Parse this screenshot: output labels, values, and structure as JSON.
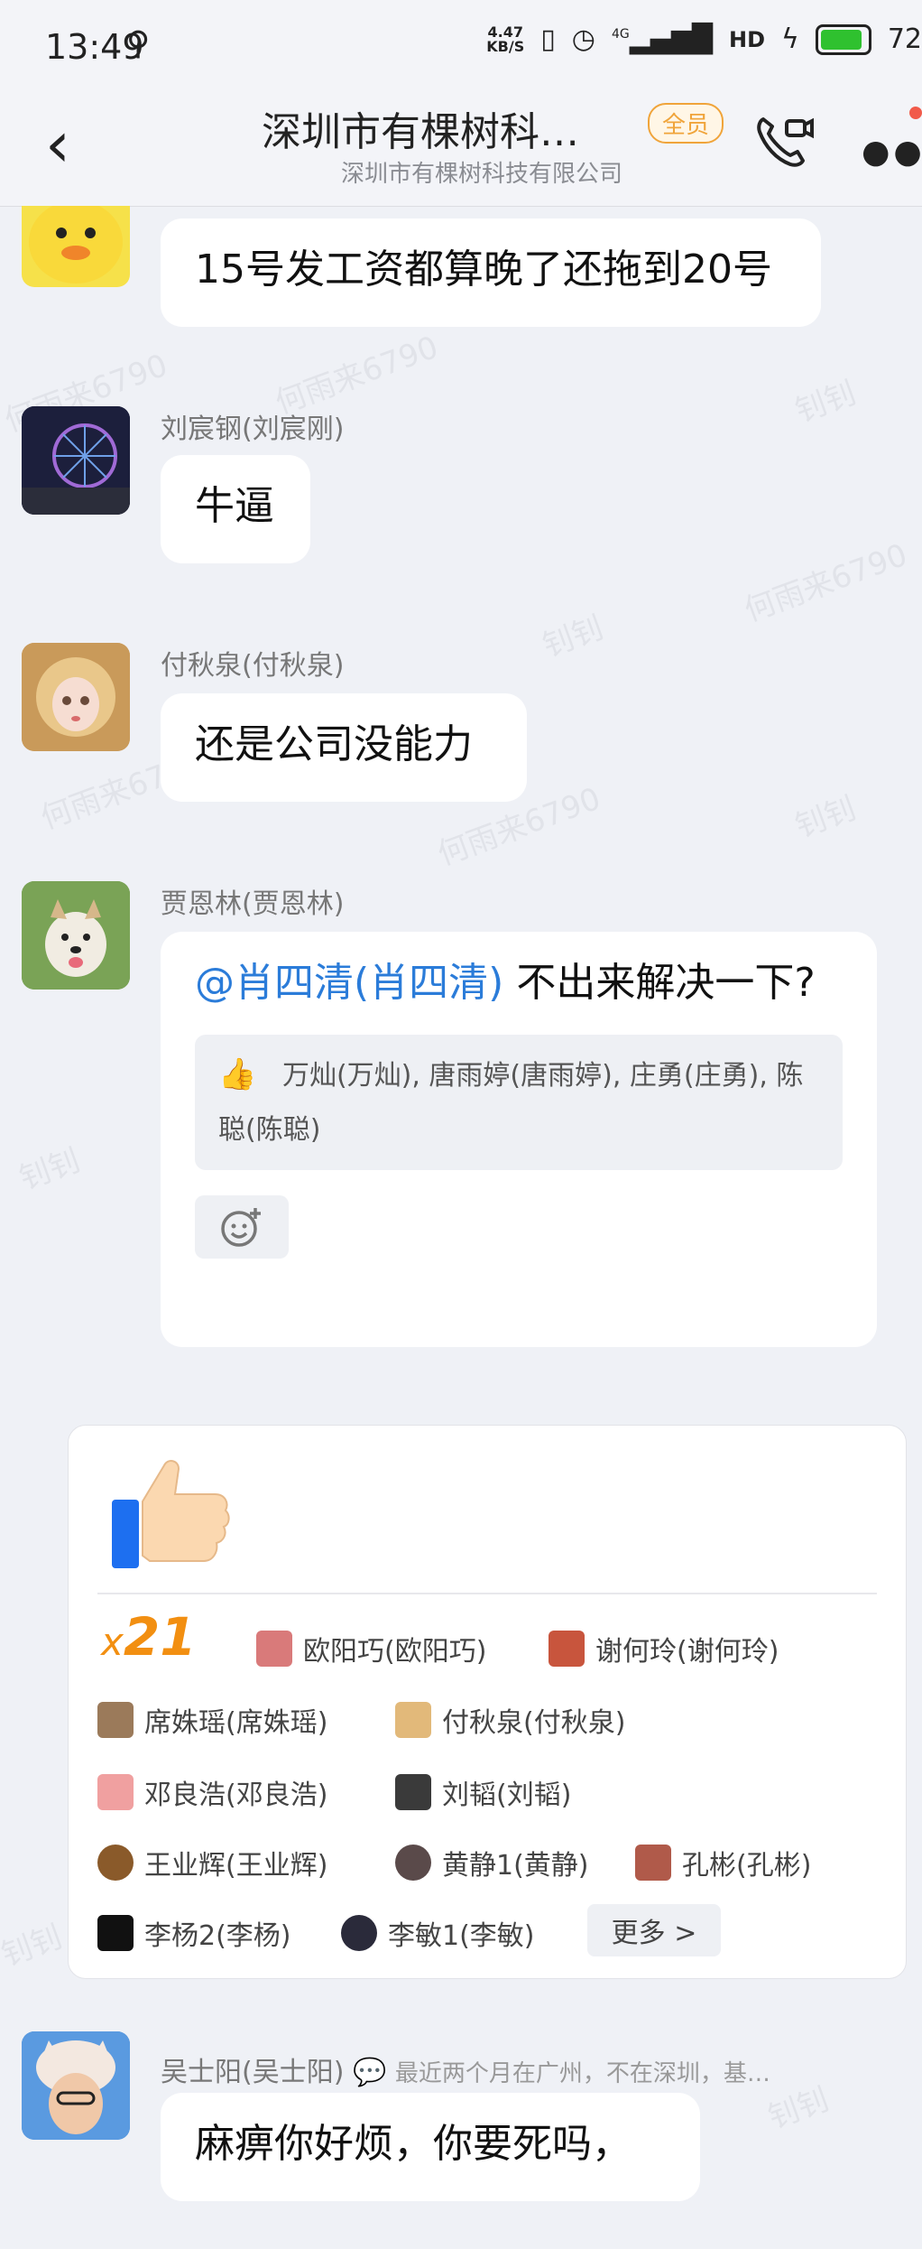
{
  "status_bar": {
    "time": "13:49",
    "usb_icon": "usb-icon",
    "net_speed_value": "4.47",
    "net_speed_unit": "KB/S",
    "network": "4G",
    "hd": "HD",
    "battery": "72"
  },
  "header": {
    "back_icon": "chevron-left-icon",
    "title": "深圳市有棵树科…",
    "badge": "全员",
    "subtitle": "深圳市有棵树科技有限公司",
    "call_icon": "video-call-icon",
    "more_icon": "more-icon"
  },
  "messages": [
    {
      "sender": "",
      "text": "15号发工资都算晚了还拖到20号"
    },
    {
      "sender": "刘宸钢(刘宸刚)",
      "text": "牛逼"
    },
    {
      "sender": "付秋泉(付秋泉)",
      "text": "还是公司没能力"
    },
    {
      "sender": "贾恩林(贾恩林)",
      "mention": "@肖四清(肖四清)",
      "text": " 不出来解决一下?",
      "reactions": "万灿(万灿), 唐雨婷(唐雨婷), 庄勇(庄勇), 陈聪(陈聪)"
    },
    {
      "sender": "吴士阳(吴士阳)",
      "signature": "最近两个月在广州，不在深圳，基…",
      "text": "麻痹你好烦，你要死吗，"
    }
  ],
  "like_card": {
    "count_prefix": "x",
    "count": "21",
    "likers": [
      "欧阳巧(欧阳巧)",
      "谢何玲(谢何玲)",
      "席姝瑶(席姝瑶)",
      "付秋泉(付秋泉)",
      "邓良浩(邓良浩)",
      "刘韬(刘韬)",
      "王业辉(王业辉)",
      "黄静1(黄静)",
      "孔彬(孔彬)",
      "李杨2(李杨)",
      "李敏1(李敏)"
    ],
    "more_label": "更多 >"
  },
  "watermarks": [
    "何雨来6790",
    "钊钊"
  ],
  "colors": {
    "background": "#eff1f6",
    "mention": "#2b7cd9",
    "badge": "#f0a43a",
    "like_count": "#f28f11",
    "battery": "#2fc12f"
  }
}
